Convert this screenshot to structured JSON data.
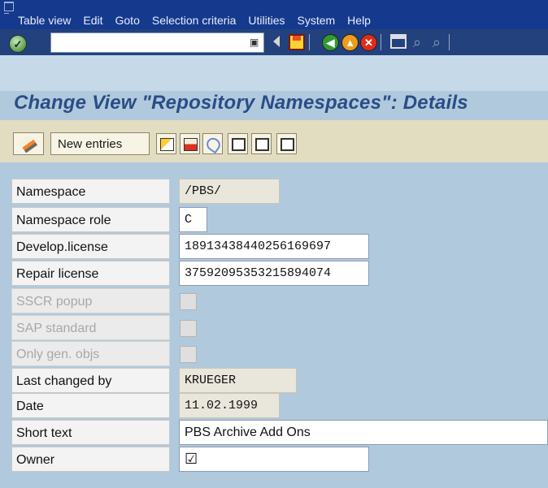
{
  "menu": {
    "items": [
      "Table view",
      "Edit",
      "Goto",
      "Selection criteria",
      "Utilities",
      "System",
      "Help"
    ]
  },
  "toolbar": {
    "command_value": "",
    "ok_icon": "check-icon"
  },
  "page": {
    "title": "Change View \"Repository Namespaces\": Details"
  },
  "app_toolbar": {
    "new_entries_label": "New entries"
  },
  "form": {
    "namespace_label": "Namespace",
    "namespace_value": "/PBS/",
    "namespace_role_label": "Namespace role",
    "namespace_role_value": "C",
    "develop_license_label": "Develop.license",
    "develop_license_value": "18913438440256169697",
    "repair_license_label": "Repair license",
    "repair_license_value": "37592095353215894074",
    "sscr_popup_label": "SSCR popup",
    "sscr_popup_checked": false,
    "sap_standard_label": "SAP standard",
    "sap_standard_checked": false,
    "only_gen_objs_label": "Only gen. objs",
    "only_gen_objs_checked": false,
    "last_changed_by_label": "Last changed by",
    "last_changed_by_value": "KRUEGER",
    "date_label": "Date",
    "date_value": "11.02.1999",
    "short_text_label": "Short text",
    "short_text_value": "PBS Archive Add Ons",
    "owner_label": "Owner",
    "owner_checked": true
  }
}
